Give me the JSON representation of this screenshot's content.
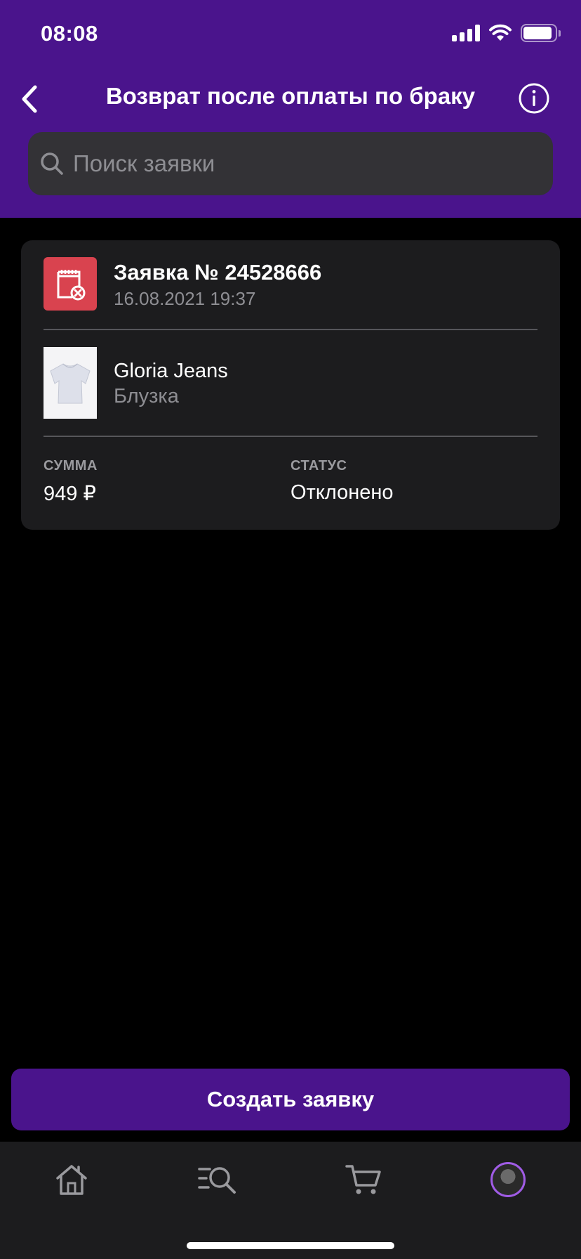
{
  "status_bar": {
    "time": "08:08"
  },
  "header": {
    "title": "Возврат после оплаты по браку"
  },
  "search": {
    "placeholder": "Поиск заявки"
  },
  "request": {
    "title": "Заявка № 24528666",
    "date": "16.08.2021 19:37",
    "brand": "Gloria Jeans",
    "item": "Блузка",
    "amount_label": "СУММА",
    "amount": "949 ₽",
    "status_label": "СТАТУС",
    "status": "Отклонено"
  },
  "create_button": {
    "label": "Создать заявку"
  },
  "tabs": [
    {
      "name": "home",
      "icon": "home-icon"
    },
    {
      "name": "catalog",
      "icon": "catalog-search-icon"
    },
    {
      "name": "cart",
      "icon": "cart-icon"
    },
    {
      "name": "profile",
      "icon": "avatar"
    }
  ],
  "colors": {
    "accent": "#4a148c",
    "card": "#1c1c1e",
    "request_icon_bg": "#d9434f",
    "avatar_ring": "#a05ce6"
  }
}
